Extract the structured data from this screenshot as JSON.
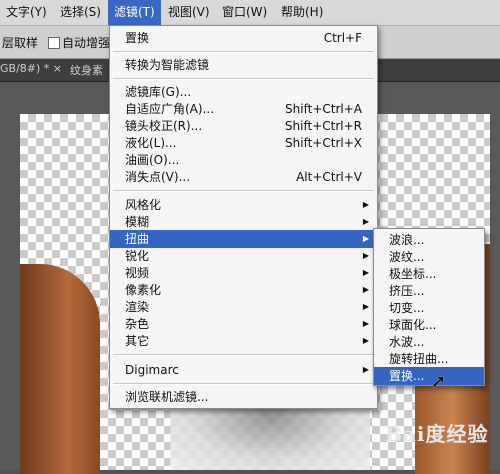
{
  "menubar": {
    "items": [
      {
        "label": "文字(Y)"
      },
      {
        "label": "选择(S)"
      },
      {
        "label": "滤镜(T)"
      },
      {
        "label": "视图(V)"
      },
      {
        "label": "窗口(W)"
      },
      {
        "label": "帮助(H)"
      }
    ]
  },
  "optionsbar": {
    "sample_layers": "层取样",
    "auto_enhance": "自动增强"
  },
  "tabs": {
    "doc_tab": "GB/8#) * ×",
    "doc_tab2": "纹身素"
  },
  "filter_menu": {
    "items": [
      {
        "label": "置换",
        "shortcut": "Ctrl+F"
      },
      {
        "label": "转换为智能滤镜"
      },
      {
        "label": "滤镜库(G)..."
      },
      {
        "label": "自适应广角(A)...",
        "shortcut": "Shift+Ctrl+A"
      },
      {
        "label": "镜头校正(R)...",
        "shortcut": "Shift+Ctrl+R"
      },
      {
        "label": "液化(L)...",
        "shortcut": "Shift+Ctrl+X"
      },
      {
        "label": "油画(O)..."
      },
      {
        "label": "消失点(V)...",
        "shortcut": "Alt+Ctrl+V"
      },
      {
        "label": "风格化"
      },
      {
        "label": "模糊"
      },
      {
        "label": "扭曲"
      },
      {
        "label": "锐化"
      },
      {
        "label": "视频"
      },
      {
        "label": "像素化"
      },
      {
        "label": "渲染"
      },
      {
        "label": "杂色"
      },
      {
        "label": "其它"
      },
      {
        "label": "Digimarc"
      },
      {
        "label": "浏览联机滤镜..."
      }
    ],
    "submenu_arrow": "▶"
  },
  "distort_submenu": {
    "items": [
      {
        "label": "波浪..."
      },
      {
        "label": "波纹..."
      },
      {
        "label": "极坐标..."
      },
      {
        "label": "挤压..."
      },
      {
        "label": "切变..."
      },
      {
        "label": "球面化..."
      },
      {
        "label": "水波..."
      },
      {
        "label": "旋转扭曲..."
      },
      {
        "label": "置换..."
      }
    ]
  },
  "watermark": "Bai度经验",
  "cursor_icon": "arrow-cursor",
  "colors": {
    "highlight": "#3465c0",
    "menubar_active": "#3a66c4"
  }
}
